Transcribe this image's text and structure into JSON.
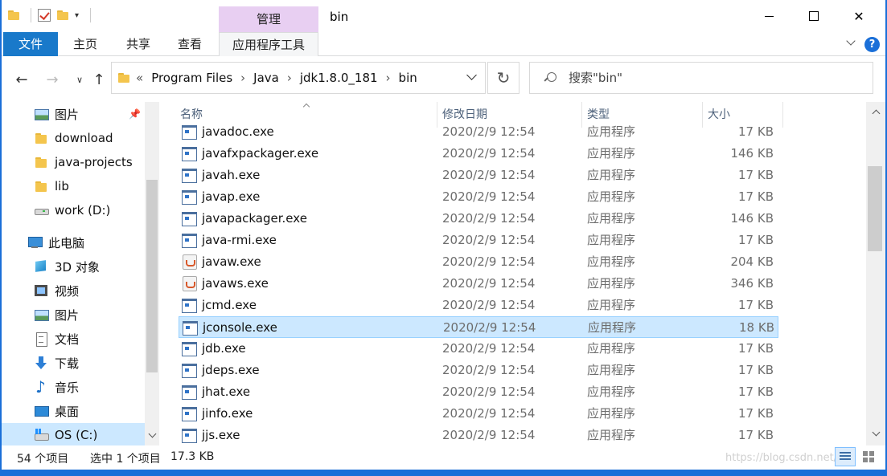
{
  "window": {
    "title": "bin",
    "manage_tab": "管理"
  },
  "ribbon": {
    "file": "文件",
    "home": "主页",
    "share": "共享",
    "view": "查看",
    "app_tools": "应用程序工具",
    "help": "?"
  },
  "address": {
    "lead": "«",
    "crumbs": [
      "Program Files",
      "Java",
      "jdk1.8.0_181",
      "bin"
    ],
    "sep": "›"
  },
  "search": {
    "placeholder": "搜索\"bin\""
  },
  "navpane": {
    "items": [
      {
        "label": "图片",
        "icon": "pictures-icon",
        "pinned": true
      },
      {
        "label": "download",
        "icon": "folder-icon"
      },
      {
        "label": "java-projects",
        "icon": "folder-icon"
      },
      {
        "label": "lib",
        "icon": "folder-icon"
      },
      {
        "label": "work (D:)",
        "icon": "drive-icon"
      },
      {
        "label": "此电脑",
        "icon": "this-pc-icon"
      },
      {
        "label": "3D 对象",
        "icon": "3d-objects-icon"
      },
      {
        "label": "视频",
        "icon": "videos-icon"
      },
      {
        "label": "图片",
        "icon": "pictures-icon"
      },
      {
        "label": "文档",
        "icon": "documents-icon"
      },
      {
        "label": "下载",
        "icon": "downloads-icon"
      },
      {
        "label": "音乐",
        "icon": "music-icon"
      },
      {
        "label": "桌面",
        "icon": "desktop-icon"
      },
      {
        "label": "OS (C:)",
        "icon": "os-drive-icon",
        "selected": true
      }
    ]
  },
  "columns": {
    "name": "名称",
    "date": "修改日期",
    "type": "类型",
    "size": "大小"
  },
  "files": [
    {
      "name": "javadoc.exe",
      "date": "2020/2/9 12:54",
      "type": "应用程序",
      "size": "17 KB",
      "icon": "exe-icon"
    },
    {
      "name": "javafxpackager.exe",
      "date": "2020/2/9 12:54",
      "type": "应用程序",
      "size": "146 KB",
      "icon": "exe-icon"
    },
    {
      "name": "javah.exe",
      "date": "2020/2/9 12:54",
      "type": "应用程序",
      "size": "17 KB",
      "icon": "exe-icon"
    },
    {
      "name": "javap.exe",
      "date": "2020/2/9 12:54",
      "type": "应用程序",
      "size": "17 KB",
      "icon": "exe-icon"
    },
    {
      "name": "javapackager.exe",
      "date": "2020/2/9 12:54",
      "type": "应用程序",
      "size": "146 KB",
      "icon": "exe-icon"
    },
    {
      "name": "java-rmi.exe",
      "date": "2020/2/9 12:54",
      "type": "应用程序",
      "size": "17 KB",
      "icon": "exe-icon"
    },
    {
      "name": "javaw.exe",
      "date": "2020/2/9 12:54",
      "type": "应用程序",
      "size": "204 KB",
      "icon": "java-icon"
    },
    {
      "name": "javaws.exe",
      "date": "2020/2/9 12:54",
      "type": "应用程序",
      "size": "346 KB",
      "icon": "java-icon"
    },
    {
      "name": "jcmd.exe",
      "date": "2020/2/9 12:54",
      "type": "应用程序",
      "size": "17 KB",
      "icon": "exe-icon"
    },
    {
      "name": "jconsole.exe",
      "date": "2020/2/9 12:54",
      "type": "应用程序",
      "size": "18 KB",
      "icon": "exe-icon",
      "selected": true
    },
    {
      "name": "jdb.exe",
      "date": "2020/2/9 12:54",
      "type": "应用程序",
      "size": "17 KB",
      "icon": "exe-icon"
    },
    {
      "name": "jdeps.exe",
      "date": "2020/2/9 12:54",
      "type": "应用程序",
      "size": "17 KB",
      "icon": "exe-icon"
    },
    {
      "name": "jhat.exe",
      "date": "2020/2/9 12:54",
      "type": "应用程序",
      "size": "17 KB",
      "icon": "exe-icon"
    },
    {
      "name": "jinfo.exe",
      "date": "2020/2/9 12:54",
      "type": "应用程序",
      "size": "17 KB",
      "icon": "exe-icon"
    },
    {
      "name": "jjs.exe",
      "date": "2020/2/9 12:54",
      "type": "应用程序",
      "size": "17 KB",
      "icon": "exe-icon"
    }
  ],
  "status": {
    "count": "54 个项目",
    "selection": "选中 1 个项目",
    "size": "17.3 KB",
    "watermark": "https://blog.csdn.net/..."
  },
  "colors": {
    "accent": "#1979ca",
    "selection": "#cce8ff",
    "manage_tab": "#e8cff2"
  }
}
